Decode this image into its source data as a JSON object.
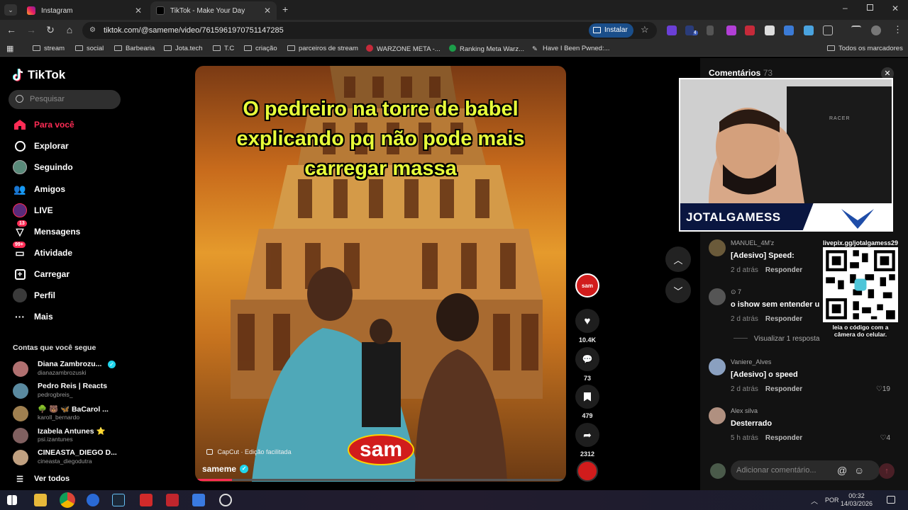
{
  "browser": {
    "tabs": [
      {
        "title": "Instagram",
        "active": false
      },
      {
        "title": "TikTok - Make Your Day",
        "active": true
      }
    ],
    "new_tab": "+",
    "url": "tiktok.com/@sameme/video/7615961970751147285",
    "install_label": "Instalar",
    "bookmarks": [
      "stream",
      "social",
      "Barbearia",
      "Jota.tech",
      "T.C",
      "criação",
      "parceiros de stream",
      "WARZONE META -...",
      "Ranking Meta Warz...",
      "Have I Been Pwned:..."
    ],
    "all_bookmarks": "Todos os marcadores",
    "ext_badge": "14"
  },
  "sidebar": {
    "logo": "TikTok",
    "search_placeholder": "Pesquisar",
    "nav": [
      {
        "label": "Para você",
        "icon": "home-icon",
        "active": true
      },
      {
        "label": "Explorar",
        "icon": "compass-icon"
      },
      {
        "label": "Seguindo",
        "icon": "following-avatar-icon"
      },
      {
        "label": "Amigos",
        "icon": "friends-icon"
      },
      {
        "label": "LIVE",
        "icon": "live-icon"
      },
      {
        "label": "Mensagens",
        "icon": "messages-icon",
        "badge": "13"
      },
      {
        "label": "Atividade",
        "icon": "activity-icon",
        "badge": "99+"
      },
      {
        "label": "Carregar",
        "icon": "upload-icon"
      },
      {
        "label": "Perfil",
        "icon": "profile-icon"
      },
      {
        "label": "Mais",
        "icon": "more-icon"
      }
    ],
    "following_heading": "Contas que você segue",
    "accounts": [
      {
        "name": "Diana Zambrozu...",
        "handle": "dianazambrozuski",
        "verified": true
      },
      {
        "name": "Pedro Reis | Reacts",
        "handle": "pedrogbreis_"
      },
      {
        "name": "🌳 🐻 🦋 BaCarol ...",
        "handle": "karoll_bernardo"
      },
      {
        "name": "Izabela Antunes ⭐",
        "handle": "psi.izantunes"
      },
      {
        "name": "CINEASTA_DIEGO D...",
        "handle": "cineasta_diegodutra"
      }
    ],
    "see_all": "Ver todos"
  },
  "video": {
    "caption": [
      "O pedreiro na torre de babel",
      "explicando pq não pode mais",
      "carregar massa"
    ],
    "capcut_label": "CapCut · Edição facilitada",
    "author": "sameme",
    "watermark": "sam",
    "progress": 0.1
  },
  "actions": {
    "likes": "10.4K",
    "comments": "73",
    "saves": "479",
    "shares": "2312"
  },
  "comments": {
    "title": "Comentários",
    "count": "73",
    "items": [
      {
        "user": "MANUEL_4M'z",
        "text": "[Adesivo] Speed:",
        "time": "2 d atrás",
        "reply": "Responder",
        "likes": ""
      },
      {
        "user": "7",
        "text": "o ishow sem entender u",
        "time": "2 d atrás",
        "reply": "Responder",
        "likes": ""
      },
      {
        "user": "Vaniere_Alves",
        "text": "[Adesivo] o speed",
        "time": "2 d atrás",
        "reply": "Responder",
        "likes": "19"
      },
      {
        "user": "Alex silva",
        "text": "Desterrado",
        "time": "5 h atrás",
        "reply": "Responder",
        "likes": "4"
      }
    ],
    "view_replies": "Visualizar 1 resposta",
    "input_placeholder": "Adicionar comentário..."
  },
  "overlay": {
    "streamer": "JOTALGAMESS",
    "chair_brand": "RACER",
    "qr_url": "livepix.gg/jotalgamess29",
    "qr_caption": "leia o código com a câmera do celular."
  },
  "taskbar": {
    "lang": "POR",
    "time": "00:32",
    "date": "14/03/2026"
  },
  "colors": {
    "accent": "#fe2c55",
    "caption": "#e8ff3a",
    "chrome": "#2b2b2b"
  }
}
